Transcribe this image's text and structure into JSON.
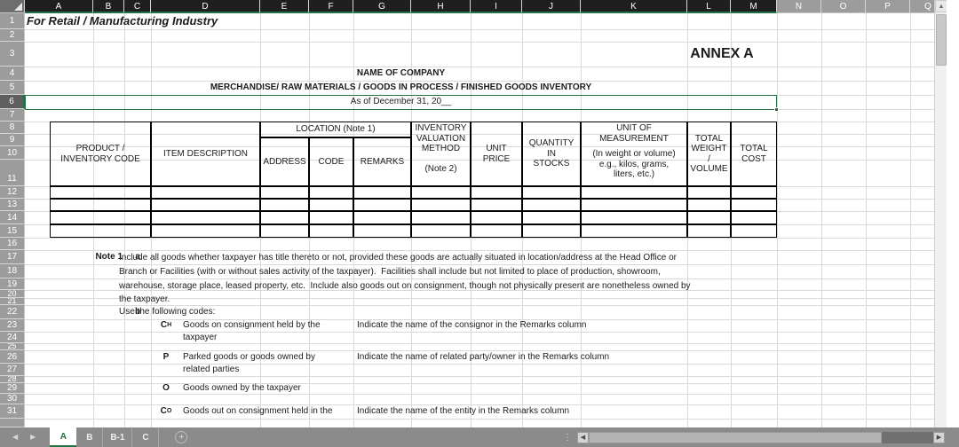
{
  "app": {
    "column_headers": [
      "A",
      "B",
      "C",
      "D",
      "E",
      "F",
      "G",
      "H",
      "I",
      "J",
      "K",
      "L",
      "M",
      "N",
      "O",
      "P",
      "Q"
    ],
    "selected_columns": [
      "A",
      "B",
      "C",
      "D",
      "E",
      "F",
      "G",
      "H",
      "I",
      "J",
      "K",
      "L",
      "M"
    ],
    "row_headers": [
      "1",
      "2",
      "3",
      "4",
      "5",
      "6",
      "7",
      "8",
      "9",
      "10",
      "11",
      "12",
      "13",
      "14",
      "15",
      "16",
      "17",
      "18",
      "19",
      "20",
      "21",
      "22",
      "23",
      "24",
      "25",
      "26",
      "27",
      "28",
      "29",
      "30",
      "31"
    ],
    "selected_row": "6",
    "accent_color": "#217346",
    "header_selected_color": "#1f1f1f",
    "header_color": "#9c9c9c"
  },
  "sheet": {
    "title_banner": "For Retail / Manufacturing Industry",
    "annex_label": "ANNEX A",
    "company_name_placeholder": "NAME OF COMPANY",
    "report_title": "MERCHANDISE/ RAW MATERIALS / GOODS IN PROCESS / FINISHED GOODS INVENTORY",
    "as_of_line": "As of December 31, 20__"
  },
  "table": {
    "headers": {
      "product_inventory_code": "PRODUCT /\nINVENTORY CODE",
      "item_description": "ITEM DESCRIPTION",
      "location_group": "LOCATION (Note 1)",
      "address": "ADDRESS",
      "code": "CODE",
      "remarks": "REMARKS",
      "inventory_valuation_method": "INVENTORY\nVALUATION\nMETHOD",
      "inventory_valuation_note": "(Note 2)",
      "unit_price": "UNIT\nPRICE",
      "quantity_in_stocks": "QUANTITY IN\nSTOCKS",
      "unit_of_measurement": "UNIT OF\nMEASUREMENT",
      "unit_of_measurement_sub": "(In weight or volume)\ne.g., kilos, grams,\nliters, etc.)",
      "total_weight_volume": "TOTAL\nWEIGHT /\nVOLUME",
      "total_cost": "TOTAL\nCOST"
    },
    "empty_row_count": 4
  },
  "notes": {
    "note1_label": "Note 1",
    "item_a_marker": "a",
    "item_a_text": "Include all goods whether taxpayer has title thereto or not, provided these goods are actually situated in location/address at the Head Office or Branch or Facilities (with or without sales activity of the taxpayer).  Facilities shall include but not limited to place of production, showroom, warehouse, storage place, leased property, etc.  Include also goods out on consignment, though not physically present are nonetheless owned by the taxpayer.",
    "item_b_marker": "b",
    "item_b_text": "Use the following codes:",
    "codes": [
      {
        "code_main": "C",
        "code_sub": "H",
        "description": "Goods on consignment held by the\ntaxpayer",
        "remark": "Indicate the name of the consignor in the Remarks column"
      },
      {
        "code_main": "P",
        "code_sub": "",
        "description": "Parked goods or goods owned by\nrelated parties",
        "remark": "Indicate the name of related party/owner in the Remarks column"
      },
      {
        "code_main": "O",
        "code_sub": "",
        "description": "Goods owned by the taxpayer",
        "remark": ""
      },
      {
        "code_main": "C",
        "code_sub": "O",
        "description": "Goods out on consignment held in the",
        "remark": "Indicate the name of the entity in the Remarks column"
      }
    ]
  },
  "sheet_tabs": {
    "tabs": [
      {
        "label": "A",
        "active": true
      },
      {
        "label": "B",
        "active": false
      },
      {
        "label": "B-1",
        "active": false
      },
      {
        "label": "C",
        "active": false
      }
    ],
    "add_sheet_label": "+",
    "prev_arrow": "◀",
    "next_arrow": "▶"
  },
  "scrollbars": {
    "v_up": "▲",
    "h_left": "◀",
    "h_right": "▶"
  }
}
